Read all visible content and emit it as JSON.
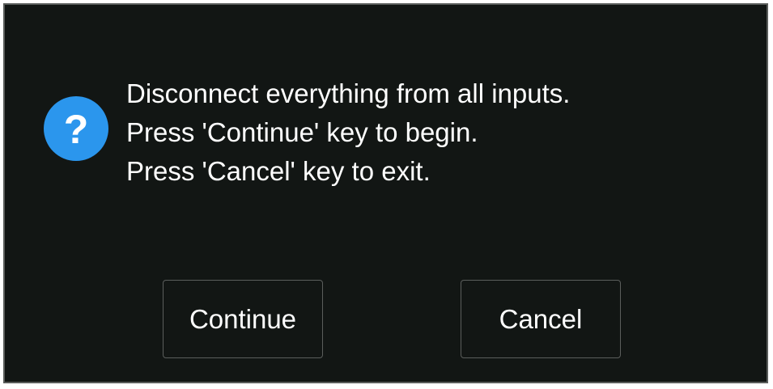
{
  "dialog": {
    "icon": "question-icon",
    "icon_glyph": "?",
    "icon_color": "#2b96ed",
    "background_color": "#121614",
    "message_lines": [
      "Disconnect everything from all inputs.",
      "Press 'Continue' key to begin.",
      "Press 'Cancel' key to exit."
    ],
    "buttons": {
      "continue_label": "Continue",
      "cancel_label": "Cancel"
    }
  }
}
